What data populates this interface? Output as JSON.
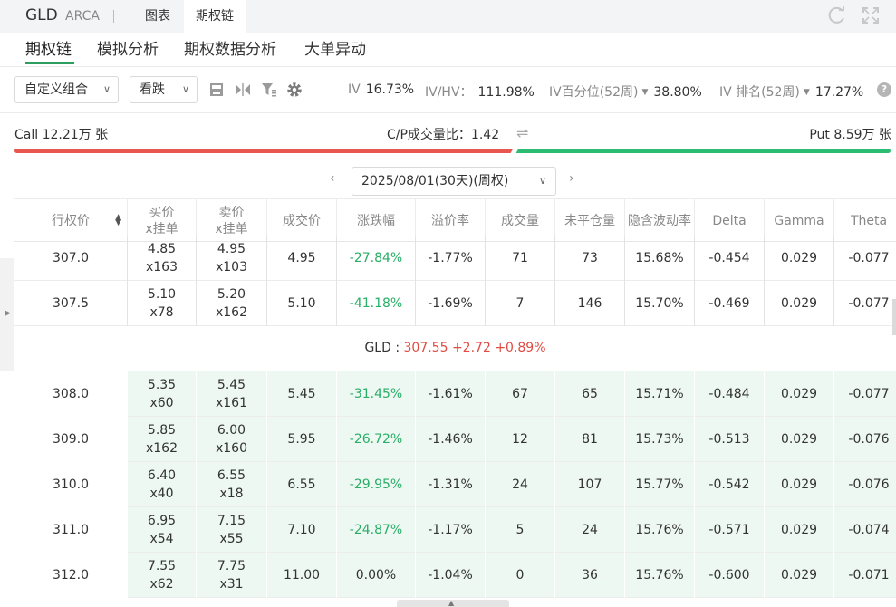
{
  "header": {
    "symbol": "GLD",
    "exchange": "ARCA",
    "tabs": [
      "图表",
      "期权链"
    ],
    "active_tab": "期权链"
  },
  "subnav": {
    "items": [
      "期权链",
      "模拟分析",
      "期权数据分析",
      "大单异动"
    ],
    "active": "期权链"
  },
  "controls": {
    "strategy_select": "自定义组合",
    "direction_select": "看跌"
  },
  "metrics": {
    "iv_label": "IV",
    "iv_value": "16.73%",
    "ivhv_label": "IV/HV：",
    "ivhv_value": "111.98%",
    "ivpct_label": "IV百分位(52周)",
    "ivpct_value": "38.80%",
    "ivrank_label": "IV 排名(52周)",
    "ivrank_value": "17.27%"
  },
  "callput": {
    "call_text": "Call 12.21万 张",
    "ratio_text": "C/P成交量比：1.42",
    "put_text": "Put 8.59万 张",
    "call_share": 0.587
  },
  "expiry": {
    "selected": "2025/08/01(30天)(周权)"
  },
  "table": {
    "headers": [
      "行权价",
      "买价\nx挂单",
      "卖价\nx挂单",
      "成交价",
      "涨跌幅",
      "溢价率",
      "成交量",
      "未平仓量",
      "隐含波动率",
      "Delta",
      "Gamma",
      "Theta"
    ],
    "rows_above": [
      {
        "strike": "307.0",
        "bid": "4.85",
        "bid_size": "x163",
        "ask": "4.95",
        "ask_size": "x103",
        "last": "4.95",
        "change": "-27.84%",
        "premium": "-1.77%",
        "volume": "71",
        "oi": "73",
        "iv": "15.68%",
        "delta": "-0.454",
        "gamma": "0.029",
        "theta": "-0.077"
      },
      {
        "strike": "307.5",
        "bid": "5.10",
        "bid_size": "x78",
        "ask": "5.20",
        "ask_size": "x162",
        "last": "5.10",
        "change": "-41.18%",
        "premium": "-1.69%",
        "volume": "7",
        "oi": "146",
        "iv": "15.70%",
        "delta": "-0.469",
        "gamma": "0.029",
        "theta": "-0.077"
      }
    ],
    "underlying": {
      "label": "GLD : ",
      "price": "307.55",
      "change": "+2.72",
      "change_pct": "+0.89%"
    },
    "rows_below": [
      {
        "strike": "308.0",
        "bid": "5.35",
        "bid_size": "x60",
        "ask": "5.45",
        "ask_size": "x161",
        "last": "5.45",
        "change": "-31.45%",
        "premium": "-1.61%",
        "volume": "67",
        "oi": "65",
        "iv": "15.71%",
        "delta": "-0.484",
        "gamma": "0.029",
        "theta": "-0.077"
      },
      {
        "strike": "309.0",
        "bid": "5.85",
        "bid_size": "x162",
        "ask": "6.00",
        "ask_size": "x160",
        "last": "5.95",
        "change": "-26.72%",
        "premium": "-1.46%",
        "volume": "12",
        "oi": "81",
        "iv": "15.73%",
        "delta": "-0.513",
        "gamma": "0.029",
        "theta": "-0.076"
      },
      {
        "strike": "310.0",
        "bid": "6.40",
        "bid_size": "x40",
        "ask": "6.55",
        "ask_size": "x18",
        "last": "6.55",
        "change": "-29.95%",
        "premium": "-1.31%",
        "volume": "24",
        "oi": "107",
        "iv": "15.77%",
        "delta": "-0.542",
        "gamma": "0.029",
        "theta": "-0.076"
      },
      {
        "strike": "311.0",
        "bid": "6.95",
        "bid_size": "x54",
        "ask": "7.15",
        "ask_size": "x55",
        "last": "7.10",
        "change": "-24.87%",
        "premium": "-1.17%",
        "volume": "5",
        "oi": "24",
        "iv": "15.76%",
        "delta": "-0.571",
        "gamma": "0.029",
        "theta": "-0.074"
      },
      {
        "strike": "312.0",
        "bid": "7.55",
        "bid_size": "x62",
        "ask": "7.75",
        "ask_size": "x31",
        "last": "11.00",
        "change": "0.00%",
        "premium": "-1.04%",
        "volume": "0",
        "oi": "36",
        "iv": "15.76%",
        "delta": "-0.600",
        "gamma": "0.029",
        "theta": "-0.071"
      }
    ]
  },
  "colors": {
    "accent_green": "#2d9e5f",
    "call_red": "#e8574f",
    "put_green": "#2dbd72",
    "change_green": "#2aae67",
    "price_red": "#e04b43",
    "itm_bg": "#edf8f2"
  },
  "icons": [
    "refresh-icon",
    "fullscreen-icon",
    "save-icon",
    "split-icon",
    "filter-icon",
    "settings-icon",
    "swap-icon",
    "help-icon"
  ]
}
